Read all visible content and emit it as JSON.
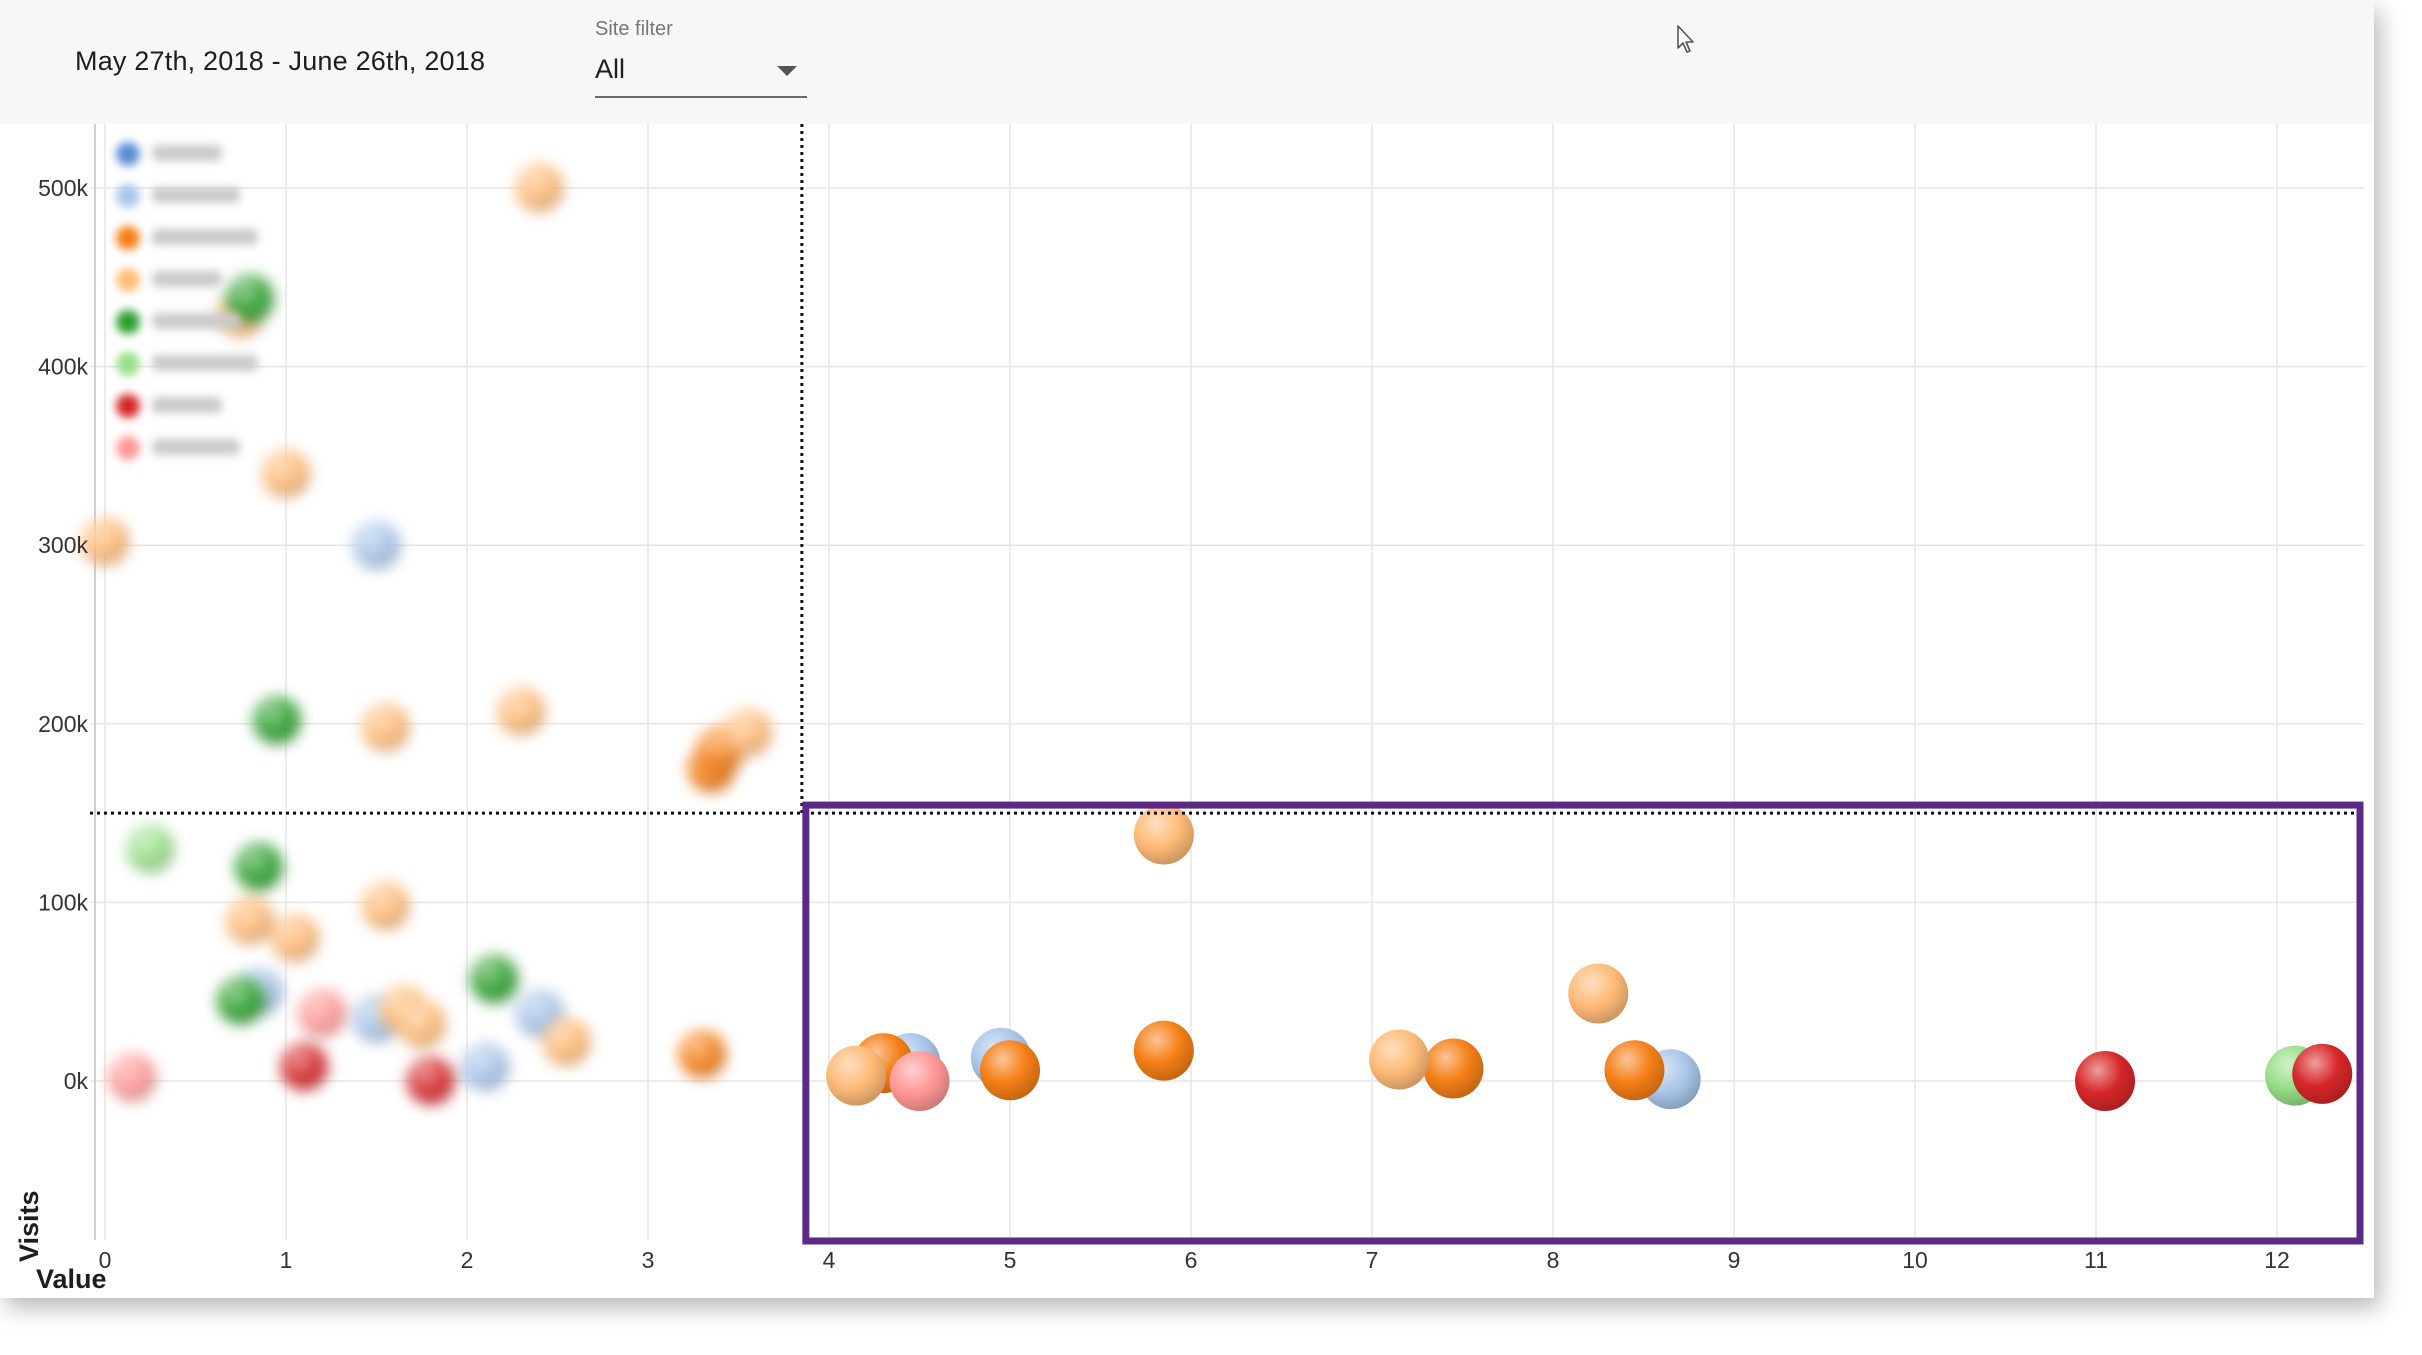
{
  "header": {
    "date_range": "May 27th, 2018 - June 26th, 2018",
    "site_filter_label": "Site filter",
    "site_filter_value": "All"
  },
  "chart_data": {
    "type": "scatter",
    "xlabel": "Value",
    "ylabel": "Visits",
    "xlim": [
      -0.07,
      12.5
    ],
    "ylim": [
      -90000,
      520000
    ],
    "x_ticks": [
      0,
      1,
      2,
      3,
      4,
      5,
      6,
      7,
      8,
      9,
      10,
      11,
      12
    ],
    "y_ticks": [
      0,
      100000,
      200000,
      300000,
      400000,
      500000
    ],
    "y_tick_labels": [
      "0k",
      "100k",
      "200k",
      "300k",
      "400k",
      "500k"
    ],
    "grid": true,
    "legend_position": "top-left (blurred)",
    "thresholds": {
      "x": 3.85,
      "y": 150000
    },
    "highlight_region": {
      "x": [
        3.85,
        12.5
      ],
      "y": [
        -90000,
        150000
      ],
      "color": "#5b2a86"
    },
    "series": [
      {
        "color": "#5b8fd6",
        "points": []
      },
      {
        "color": "#a9c6ea",
        "points": [
          [
            1.5,
            300000
          ],
          [
            0.85,
            50000
          ],
          [
            1.5,
            35000
          ],
          [
            2.4,
            38000
          ],
          [
            2.1,
            8000
          ],
          [
            4.45,
            10000
          ],
          [
            4.95,
            13000
          ],
          [
            8.65,
            1000
          ]
        ]
      },
      {
        "color": "#f57f17",
        "points": [
          [
            3.35,
            175000
          ],
          [
            3.4,
            185000
          ],
          [
            3.3,
            15000
          ],
          [
            4.3,
            10000
          ],
          [
            5.85,
            17000
          ],
          [
            5.0,
            6000
          ],
          [
            7.45,
            7000
          ],
          [
            8.45,
            6000
          ]
        ]
      },
      {
        "color": "#ffbb78",
        "points": [
          [
            2.4,
            500000
          ],
          [
            0.75,
            430000
          ],
          [
            1.0,
            340000
          ],
          [
            0.0,
            302000
          ],
          [
            1.55,
            198000
          ],
          [
            2.3,
            207000
          ],
          [
            3.55,
            195000
          ],
          [
            1.55,
            98000
          ],
          [
            0.8,
            90000
          ],
          [
            1.05,
            80000
          ],
          [
            1.65,
            40000
          ],
          [
            1.75,
            32000
          ],
          [
            2.55,
            22000
          ],
          [
            4.15,
            3000
          ],
          [
            5.85,
            138000
          ],
          [
            7.15,
            12000
          ],
          [
            8.25,
            49000
          ]
        ]
      },
      {
        "color": "#2ca02c",
        "points": [
          [
            0.8,
            438000
          ],
          [
            0.95,
            202000
          ],
          [
            0.85,
            120000
          ],
          [
            2.15,
            57000
          ],
          [
            0.75,
            45000
          ]
        ]
      },
      {
        "color": "#98df8a",
        "points": [
          [
            0.25,
            130000
          ],
          [
            12.1,
            3000
          ]
        ]
      },
      {
        "color": "#d62728",
        "points": [
          [
            1.1,
            8000
          ],
          [
            1.8,
            0
          ],
          [
            11.05,
            0
          ],
          [
            12.25,
            4000
          ]
        ]
      },
      {
        "color": "#ff9896",
        "points": [
          [
            0.15,
            2000
          ],
          [
            1.2,
            38000
          ],
          [
            4.5,
            0
          ]
        ]
      }
    ]
  }
}
